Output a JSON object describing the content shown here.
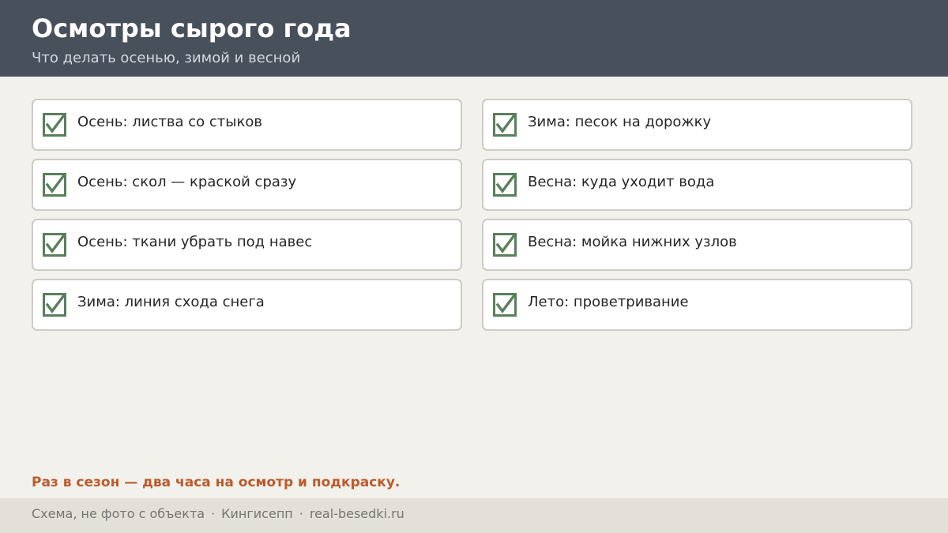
{
  "header": {
    "title": "Осмотры сырого года",
    "subtitle": "Что делать осенью, зимой и весной"
  },
  "checklist": {
    "check_icon": "checkbox-checked-icon",
    "check_color": "#5a7f5b",
    "left": [
      {
        "label": "Осень: листва со стыков",
        "checked": true
      },
      {
        "label": "Осень: скол — краской сразу",
        "checked": true
      },
      {
        "label": "Осень: ткани убрать под навес",
        "checked": true
      },
      {
        "label": "Зима: линия схода снега",
        "checked": true
      }
    ],
    "right": [
      {
        "label": "Зима: песок на дорожку",
        "checked": true
      },
      {
        "label": "Весна: куда уходит вода",
        "checked": true
      },
      {
        "label": "Весна: мойка нижних узлов",
        "checked": true
      },
      {
        "label": "Лето: проветривание",
        "checked": true
      }
    ]
  },
  "note": "Раз в сезон — два часа на осмотр и подкраску.",
  "footer": {
    "caption": "Схема, не фото с объекта",
    "separator": "·",
    "city": "Кингисепп",
    "site": "real-besedki.ru"
  },
  "colors": {
    "header_bg": "#48505c",
    "page_bg": "#f3f1ec",
    "accent": "#bb5a2c",
    "check": "#5a7f5b"
  }
}
